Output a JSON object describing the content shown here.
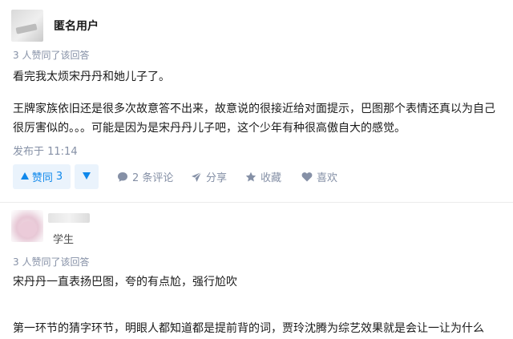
{
  "answer1": {
    "author_name": "匿名用户",
    "upvote_note": "3 人赞同了该回答",
    "paragraph1": "看完我太烦宋丹丹和她儿子了。",
    "paragraph2_line1": "王牌家族依旧还是很多次故意答不出来，故意说的很接近给对面提示，巴图那个表情还真以为自己",
    "paragraph2_line2": "很厉害似的。。。可能是因为是宋丹丹儿子吧，这个少年有种很高傲自大的感觉。",
    "published": "发布于 11:14",
    "actions": {
      "upvote_label": "赞同",
      "upvote_count": "3",
      "comments": "2 条评论",
      "share": "分享",
      "collect": "收藏",
      "like": "喜欢"
    }
  },
  "answer2": {
    "author_headline": "学生",
    "upvote_note": "3 人赞同了该回答",
    "paragraph1": "宋丹丹一直表扬巴图，夸的有点尬，强行尬吹",
    "paragraph2": "第一环节的猜字环节，明眼人都知道都是提前背的词，贾玲沈腾为综艺效果就是会让一让为什么"
  },
  "colors": {
    "accent": "#0f88eb",
    "accent_bg": "#eaf3fc",
    "meta": "#8590a6",
    "text": "#1a1a1a"
  },
  "icons": {
    "upvote": "triangle-up-icon",
    "downvote": "triangle-down-icon",
    "comment": "comment-bubble-icon",
    "share": "paper-plane-icon",
    "collect": "star-icon",
    "like": "heart-icon"
  }
}
